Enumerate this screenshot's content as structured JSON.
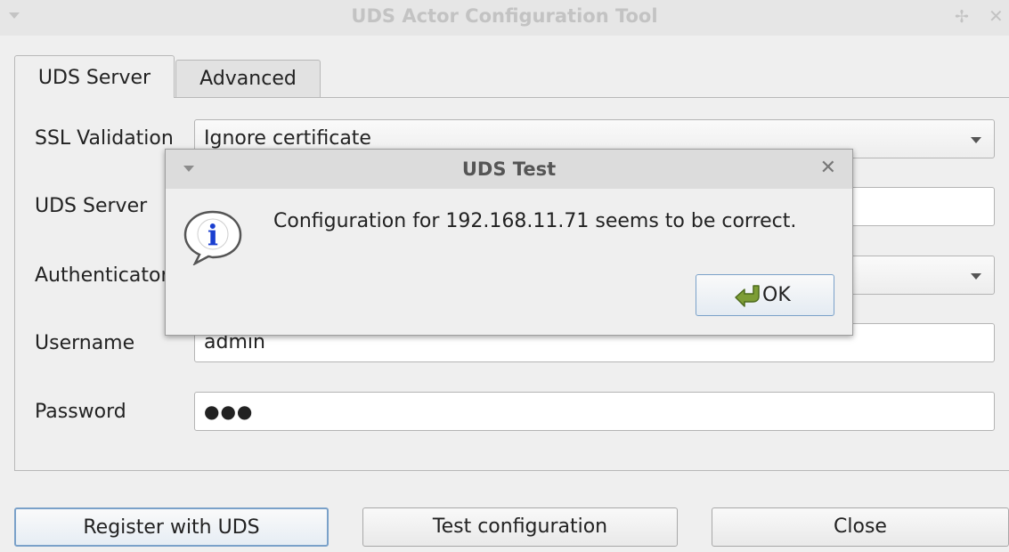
{
  "window": {
    "title": "UDS Actor Configuration Tool",
    "pin_glyph": "✢",
    "close_glyph": "✕"
  },
  "tabs": [
    {
      "label": "UDS Server",
      "active": true
    },
    {
      "label": "Advanced",
      "active": false
    }
  ],
  "form": {
    "ssl_validation": {
      "label": "SSL Validation",
      "value": "Ignore certificate"
    },
    "uds_server": {
      "label": "UDS Server",
      "value": ""
    },
    "authenticator": {
      "label": "Authenticator",
      "value": ""
    },
    "username": {
      "label": "Username",
      "value": "admin"
    },
    "password": {
      "label": "Password",
      "value": "●●●"
    }
  },
  "buttons": {
    "register": "Register with UDS",
    "test": "Test configuration",
    "close": "Close"
  },
  "dialog": {
    "title": "UDS Test",
    "close_glyph": "✕",
    "message": "Configuration for 192.168.11.71 seems to be correct.",
    "ok_label": "OK",
    "icon": "info-icon"
  },
  "colors": {
    "accent": "#7aa1c9",
    "info_icon": "#1a3fd0",
    "ok_icon": "#6a8a2a"
  }
}
